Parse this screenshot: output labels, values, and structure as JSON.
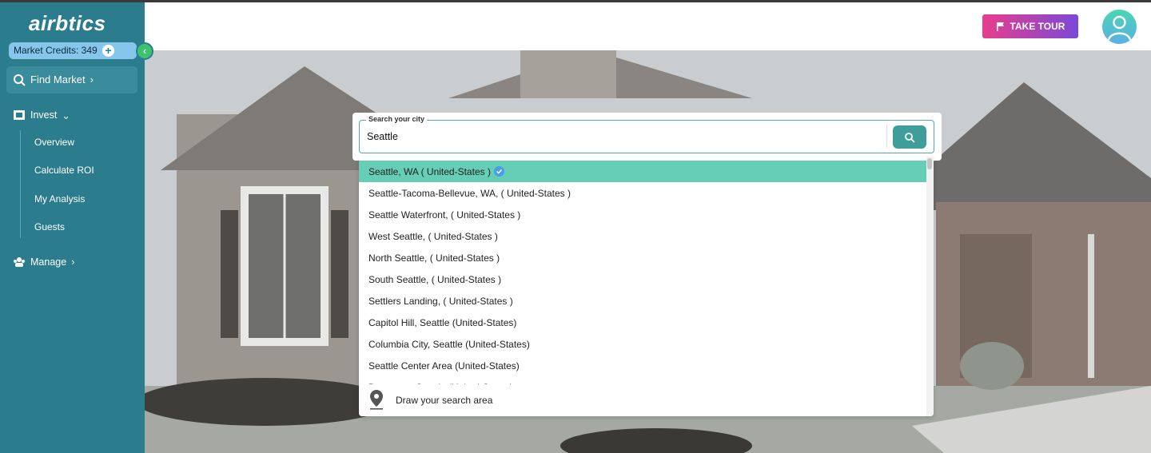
{
  "sidebar": {
    "logo": "airbtics",
    "credits_label": "Market Credits: 349",
    "find_market": "Find Market",
    "invest": "Invest",
    "invest_items": [
      "Overview",
      "Calculate ROI",
      "My Analysis",
      "Guests"
    ],
    "manage": "Manage"
  },
  "header": {
    "tour_button": "TAKE TOUR"
  },
  "search": {
    "legend": "Search your city",
    "value": "Seattle"
  },
  "dropdown": {
    "items": [
      "Seattle, WA ( United-States )",
      "Seattle-Tacoma-Bellevue, WA, ( United-States )",
      "Seattle Waterfront, ( United-States )",
      "West Seattle, ( United-States )",
      "North Seattle, ( United-States )",
      "South Seattle, ( United-States )",
      "Settlers Landing, ( United-States )",
      "Capitol Hill, Seattle (United-States)",
      "Columbia City, Seattle (United-States)",
      "Seattle Center Area (United-States)",
      "Downtown Seattle (United-States)"
    ],
    "draw_area": "Draw your search area"
  },
  "colors": {
    "sidebar": "#2b7d8e",
    "active_item": "#66cdb6",
    "accent": "#3f9e9a"
  }
}
